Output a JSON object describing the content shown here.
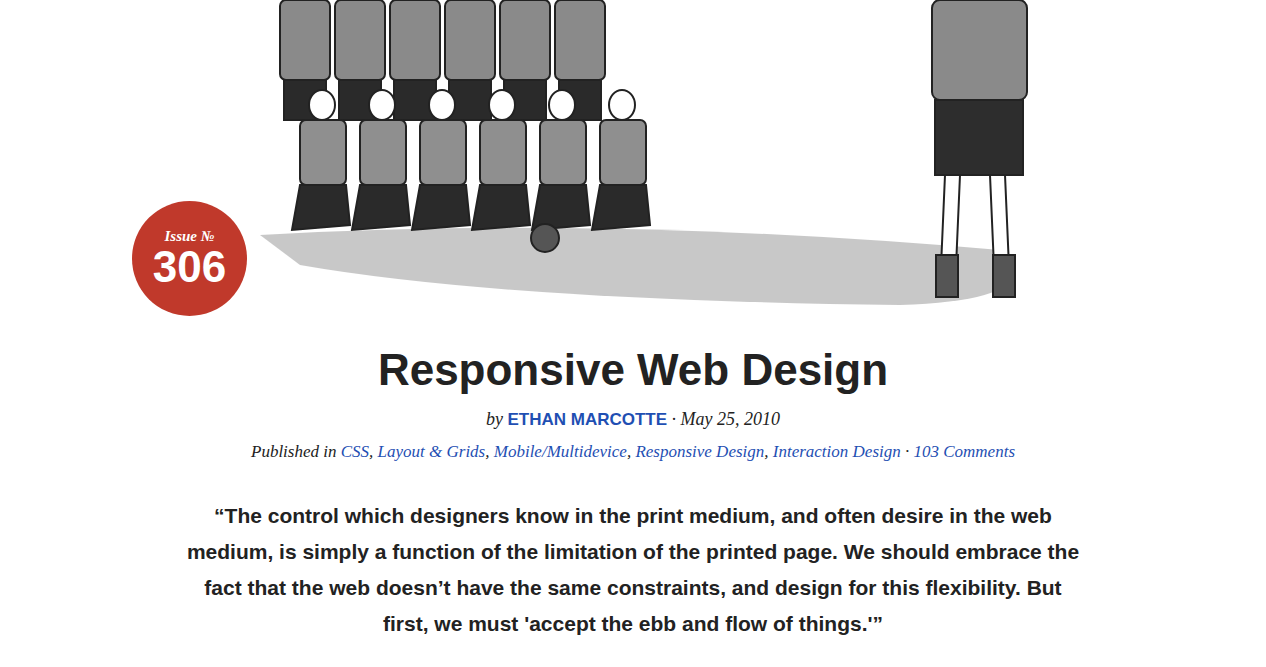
{
  "issue": {
    "label": "Issue №",
    "number": "306"
  },
  "article": {
    "title": "Responsive Web Design",
    "by": "by",
    "author": "ETHAN MARCOTTE",
    "date": "· May 25, 2010",
    "published_in": "Published in",
    "categories": [
      "CSS",
      "Layout & Grids",
      "Mobile/Multidevice",
      "Responsive Design",
      "Interaction Design"
    ],
    "list_separator": ",",
    "meta_separator": "·",
    "comments": "103 Comments"
  },
  "quote": "“The control which designers know in the print medium, and often desire in the web medium, is simply a function of the limitation of the printed page. We should embrace the fact that the web doesn’t have the same constraints, and design for this flexibility. But first, we must 'accept the ebb and flow of things.'”"
}
